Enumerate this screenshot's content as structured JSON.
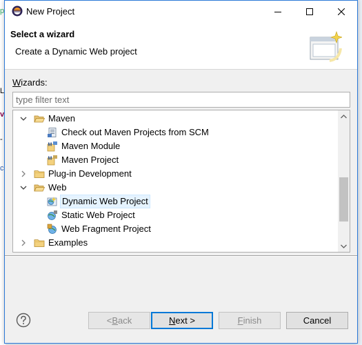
{
  "window": {
    "title": "New Project"
  },
  "banner": {
    "title": "Select a wizard",
    "description": "Create a Dynamic Web project"
  },
  "wizards_label": {
    "mnemonic": "W",
    "rest": "izards:"
  },
  "filter": {
    "placeholder": "type filter text",
    "value": ""
  },
  "tree": {
    "rows": [
      {
        "label": "Maven",
        "icon": "folder-open-icon",
        "expanded": true,
        "level": 0
      },
      {
        "label": "Check out Maven Projects from SCM",
        "icon": "maven-checkout-icon",
        "level": 1
      },
      {
        "label": "Maven Module",
        "icon": "maven-module-icon",
        "level": 1
      },
      {
        "label": "Maven Project",
        "icon": "maven-project-icon",
        "level": 1
      },
      {
        "label": "Plug-in Development",
        "icon": "folder-closed-icon",
        "expanded": false,
        "level": 0
      },
      {
        "label": "Web",
        "icon": "folder-open-icon",
        "expanded": true,
        "level": 0
      },
      {
        "label": "Dynamic Web Project",
        "icon": "dynamic-web-project-icon",
        "level": 1,
        "selected": true
      },
      {
        "label": "Static Web Project",
        "icon": "static-web-project-icon",
        "level": 1
      },
      {
        "label": "Web Fragment Project",
        "icon": "web-fragment-project-icon",
        "level": 1
      },
      {
        "label": "Examples",
        "icon": "folder-closed-icon",
        "expanded": false,
        "level": 0
      }
    ],
    "scroll_position": 0.75
  },
  "buttons": {
    "back": {
      "prefix": "< ",
      "mnemonic": "B",
      "rest": "ack",
      "enabled": false
    },
    "next": {
      "mnemonic": "N",
      "rest": "ext >",
      "enabled": true
    },
    "finish": {
      "mnemonic": "F",
      "rest": "inish",
      "enabled": false
    },
    "cancel": {
      "label": "Cancel",
      "enabled": true
    }
  },
  "colors": {
    "accent": "#0078d7",
    "selection": "#e5f3ff",
    "folder": "#dcb35c"
  }
}
